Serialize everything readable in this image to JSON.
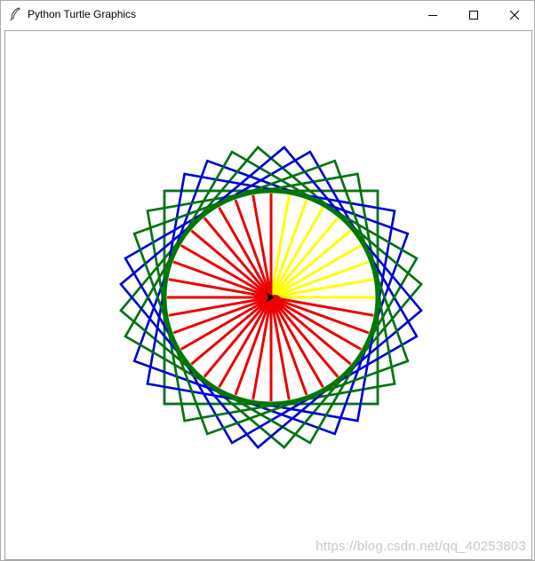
{
  "window": {
    "title": "Python Turtle Graphics",
    "icons": {
      "app": "feather-icon",
      "minimize": "minimize-icon",
      "maximize": "maximize-icon",
      "close": "close-icon"
    }
  },
  "canvas": {
    "background": "#ffffff"
  },
  "drawing": {
    "colors": {
      "inner_circle": "#007700",
      "blue_squares": "#0000dd",
      "green_squares": "#007700",
      "red_rays": "#ee0000",
      "yellow_rays": "#ffff00",
      "turtle": "#000000"
    },
    "square_count": 18,
    "ray_count": 36,
    "yellow_ray_count": 9
  },
  "watermark": {
    "text": "https://blog.csdn.net/qq_40253803"
  }
}
